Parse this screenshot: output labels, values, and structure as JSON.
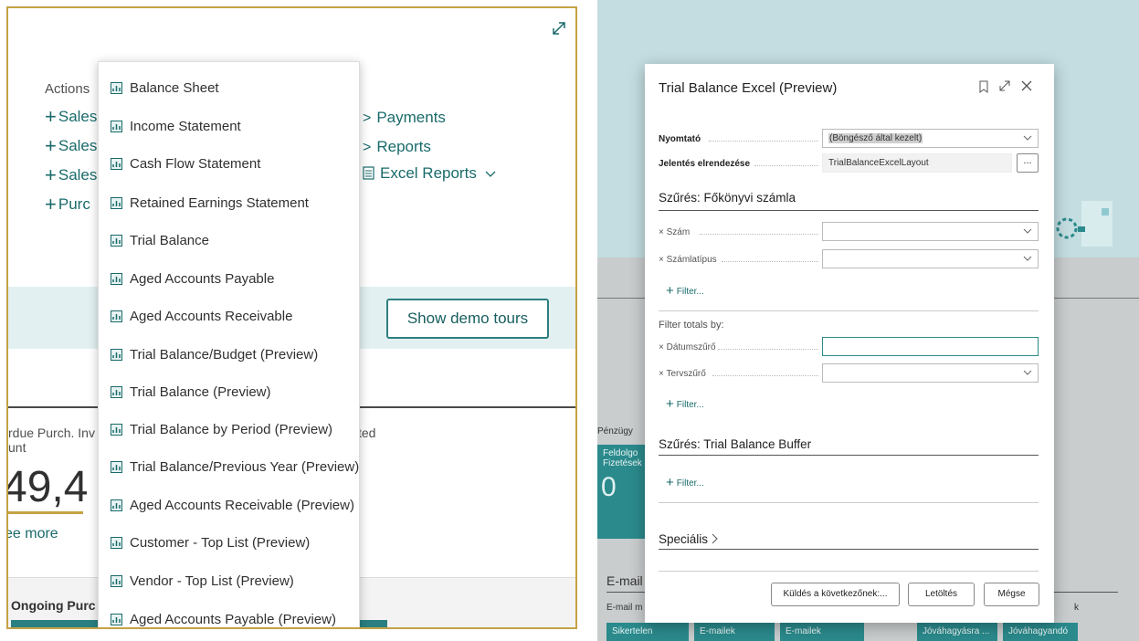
{
  "left": {
    "actions_label": "Actions",
    "action_links": [
      "Sales",
      "Sales",
      "Sales",
      "Purc"
    ],
    "right_links": [
      "Payments",
      "Reports",
      "Excel Reports"
    ],
    "show_demo_tours": "Show demo tours",
    "kpi_label_line1": "rdue Purch. Inv",
    "kpi_label_line2": "unt",
    "kpi_label_right": "cted",
    "kpi_value": "49,4",
    "see_more": "ee more",
    "ongoing_label": "Ongoing Purc",
    "dropdown_items": [
      "Balance Sheet",
      "Income Statement",
      "Cash Flow Statement",
      "Retained Earnings Statement",
      "Trial Balance",
      "Aged Accounts Payable",
      "Aged Accounts Receivable",
      "Trial Balance/Budget (Preview)",
      "Trial Balance (Preview)",
      "Trial Balance by Period (Preview)",
      "Trial Balance/Previous Year (Preview)",
      "Aged Accounts Receivable (Preview)",
      "Customer - Top List (Preview)",
      "Vendor - Top List (Preview)",
      "Aged Accounts Payable (Preview)"
    ]
  },
  "right": {
    "background": {
      "penzugy": "Pénzügy",
      "tile1_line1": "Feldolgo",
      "tile1_line2": "Fizetések",
      "tile1_value": "0",
      "email_label": "E-mail",
      "email_sub": "E-mail m",
      "email_sub_right": "k",
      "bottom_tiles": [
        {
          "l1": "Sikertelen",
          "l2": "... "
        },
        {
          "l1": "E-mailek",
          "l2": "..."
        },
        {
          "l1": "E-mailek",
          "l2": "..."
        },
        {
          "l1": "Jóváhagyásra ...",
          "l2": "..."
        },
        {
          "l1": "Jóváhagyandó",
          "l2": "..."
        }
      ]
    },
    "dialog": {
      "title": "Trial Balance Excel (Preview)",
      "fields": {
        "printer_label": "Nyomtató",
        "printer_value": "(Böngésző által kezelt)",
        "layout_label": "Jelentés elrendezése",
        "layout_value": "TrialBalanceExcelLayout",
        "ellipsis": "..."
      },
      "section1_title": "Szűrés: Főkönyvi számla",
      "section1_fields": [
        "Szám",
        "Számlatípus"
      ],
      "filter_link": "Filter...",
      "filter_totals_label": "Filter totals by:",
      "totals_fields": [
        "Dátumszűrő",
        "Tervszűrő"
      ],
      "section2_title": "Szűrés: Trial Balance Buffer",
      "section3_title": "Speciális",
      "buttons": {
        "send": "Küldés a következőnek:...",
        "download": "Letöltés",
        "cancel": "Mégse"
      }
    }
  },
  "colors": {
    "accent_teal": "#1a6a6a",
    "gold_border": "#c5a245",
    "tile_teal": "#2b8a8c"
  }
}
